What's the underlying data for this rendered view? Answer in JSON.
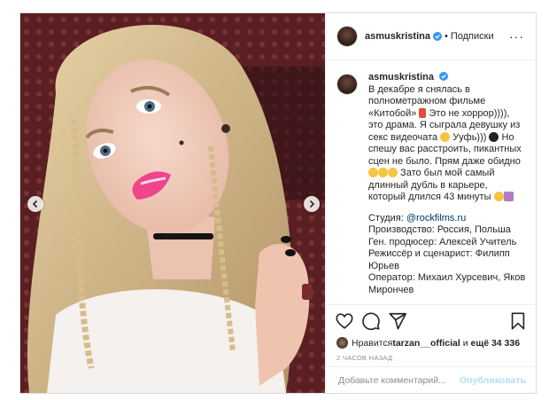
{
  "post": {
    "username": "asmuskristina",
    "follow_label": "Подписки",
    "dot": "•",
    "more_label": "···"
  },
  "caption": {
    "username": "asmuskristina",
    "line1": "В декабре я снялась в полнометражном фильме «Китобой»",
    "line1b": " Это не хоррор)))), это драма. Я сыграла девушку из секс видеочата ",
    "line1c": " Ууфь))) ",
    "line1d": " Но спешу вас расстроить, пикантных сцен не было. Прям даже обидно ",
    "line1e": " Зато был мой самый длинный дубль в карьере, который длился 43 минуты ",
    "studio_label": "Студия: ",
    "studio_link": "@rockfilms.ru",
    "production": "Производство: Россия, Польша",
    "producer": "Ген. продюсер: Алексей Учитель",
    "director": "Режиссёр и сценарист: Филипп Юрьев",
    "operator": "Оператор: Михаил Хурсевич, Яков Мирончев"
  },
  "likes": {
    "prefix": "Нравится ",
    "user": "tarzan__official",
    "middle": " и ",
    "rest": "ещё 34 336"
  },
  "time_ago": "2 ЧАСОВ НАЗАД",
  "comment": {
    "placeholder": "Добавьте комментарий...",
    "publish_label": "Опубликовать"
  },
  "colors": {
    "accent_link": "#00376b",
    "verified": "#3897f0",
    "publish_disabled": "#b2dffc"
  },
  "icons": {
    "like": "heart-icon",
    "comment": "comment-icon",
    "share": "paper-plane-icon",
    "save": "bookmark-icon",
    "verified": "verified-badge-icon",
    "prev": "chevron-left-icon",
    "next": "chevron-right-icon"
  }
}
